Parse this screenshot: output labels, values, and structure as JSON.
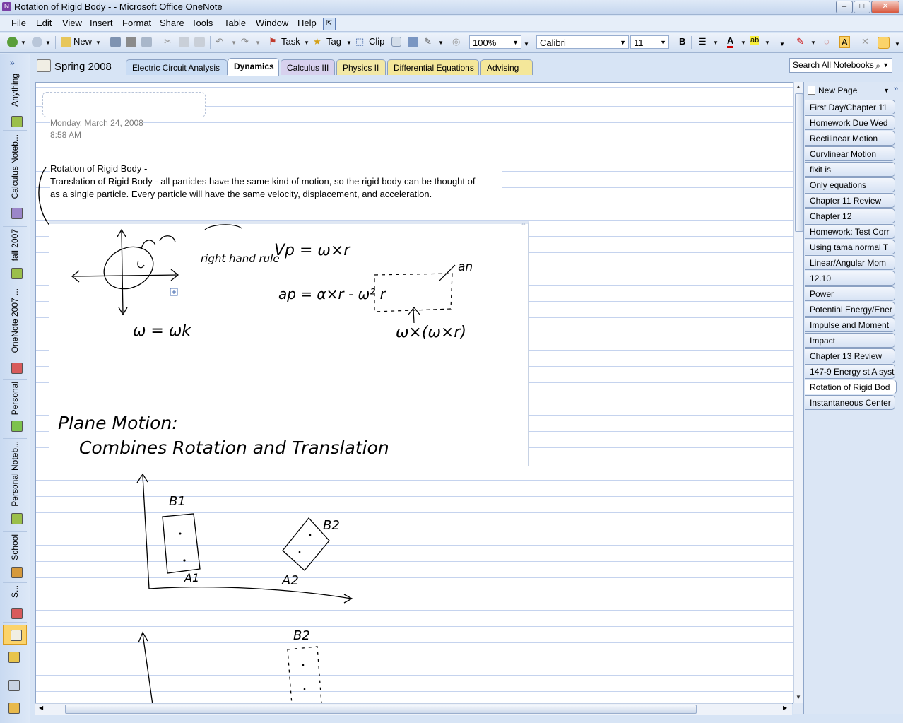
{
  "window": {
    "title": "Rotation of Rigid Body - - Microsoft Office OneNote",
    "app_icon": "onenote-icon",
    "controls": [
      "minimize",
      "maximize",
      "close"
    ]
  },
  "menu": [
    "File",
    "Edit",
    "View",
    "Insert",
    "Format",
    "Share",
    "Tools",
    "Table",
    "Window",
    "Help"
  ],
  "toolbar": {
    "new_label": "New",
    "task_label": "Task",
    "tag_label": "Tag",
    "clip_label": "Clip",
    "zoom": "100%",
    "font": "Calibri",
    "font_size": "11",
    "bold_label": "B"
  },
  "notebooks": [
    {
      "label": "Anything",
      "color": "#9bbf4a"
    },
    {
      "label": "Calculus Noteb...",
      "color": "#9b86c9"
    },
    {
      "label": "fall 2007",
      "color": "#9bbf4a"
    },
    {
      "label": "OneNote 2007 ...",
      "color": "#d85b5b"
    },
    {
      "label": "Personal",
      "color": "#7dc24d"
    },
    {
      "label": "Personal Noteb...",
      "color": "#9bbf4a"
    },
    {
      "label": "School",
      "color": "#d69a3c"
    },
    {
      "label": "S...",
      "color": "#d85b5b"
    }
  ],
  "notebook": {
    "title": "Spring 2008",
    "sections": [
      {
        "label": "Electric Circuit Analysis",
        "color": "#c9dcf4",
        "active": false
      },
      {
        "label": "Dynamics",
        "color": "#ffffff",
        "active": true
      },
      {
        "label": "Calculus III",
        "color": "#d7d1ee",
        "active": false
      },
      {
        "label": "Physics II",
        "color": "#f2e8a6",
        "active": false
      },
      {
        "label": "Differential Equations",
        "color": "#f4e79a",
        "active": false
      },
      {
        "label": "Advising",
        "color": "#f4e79a",
        "active": false
      }
    ]
  },
  "search": {
    "placeholder": "Search All Notebooks"
  },
  "page": {
    "date": "Monday, March 24, 2008",
    "time": "8:58 AM",
    "line1": "Rotation of Rigid Body -",
    "line2": "Translation of Rigid Body - all particles have the same kind of motion, so the rigid body can be thought of",
    "line3": "as a single particle.  Every particle will have the same velocity, displacement, and acceleration.",
    "ink_text": {
      "plane_motion": "Plane Motion:",
      "combines": "Combines Rotation and Translation",
      "right_hand_rule": "right hand rule",
      "vp": "Vp = ω×r",
      "ap": "ap = α×r - ω² r",
      "w_cross": "ω×(ω×r)",
      "w_eq": "ω = ωk",
      "an": "an",
      "b1": "B1",
      "a1": "A1",
      "b2": "B2",
      "a2": "A2",
      "b2b": "B2"
    }
  },
  "pages": {
    "new_page_label": "New Page",
    "items": [
      "First Day/Chapter 11",
      "Homework Due Wed",
      "Rectilinear Motion",
      "Curvlinear Motion",
      "fixit is",
      "Only equations",
      "Chapter 11 Review",
      "Chapter 12",
      "Homework: Test Corr",
      "Using tama normal T",
      "Linear/Angular Mom",
      "12.10",
      "Power",
      "Potential Energy/Ener",
      "Impulse and Moment",
      "Impact",
      "Chapter 13 Review",
      "147-9 Energy st A syst",
      "Rotation of Rigid Bod",
      "Instantaneous Center"
    ],
    "active_index": 18
  }
}
